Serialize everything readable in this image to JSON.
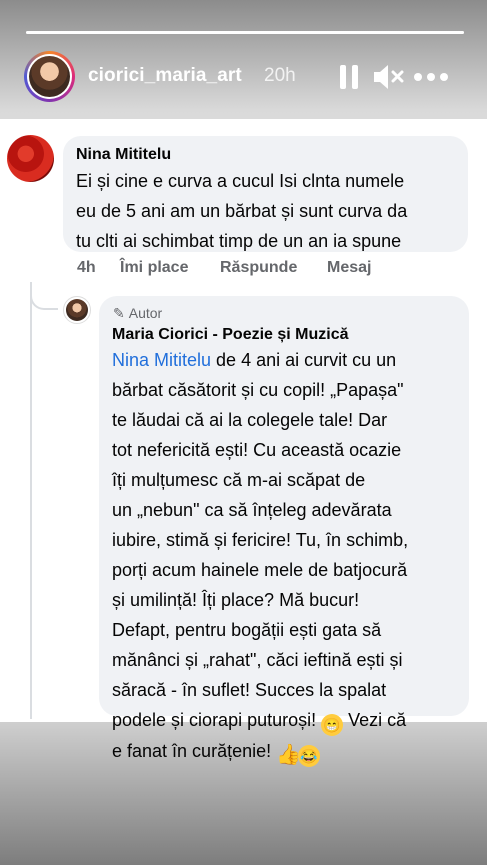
{
  "story": {
    "username": "ciorici_maria_art",
    "time_ago": "20h",
    "progress_fraction": 1.0,
    "icons": {
      "pause": "pause-icon",
      "mute": "mute-icon",
      "more": "more-icon"
    }
  },
  "comment": {
    "author": "Nina Mititelu",
    "lines": [
      "Ei și cine e curva a cucul Isi clnta numele",
      "eu de 5 ani am un bărbat și sunt curva da",
      "tu clti ai schimbat timp de un an ia spune"
    ],
    "time": "4h",
    "actions": {
      "like": "Îmi place",
      "reply": "Răspunde",
      "message": "Mesaj"
    }
  },
  "reply": {
    "badge": "Autor",
    "author": "Maria Ciorici - Poezie și Muzică",
    "mention": "Nina Mititelu",
    "first_line_rest": " de 4 ani ai curvit cu un",
    "lines": [
      "bărbat căsătorit și cu copil! „Papașa\"",
      "te lăudai că ai la colegele tale! Dar",
      "tot nefericită ești! Cu această ocazie",
      "îți mulțumesc că m-ai scăpat de",
      "un „nebun\" ca să înțeleg adevărata",
      "iubire, stimă și fericire! Tu, în schimb,",
      "porți acum hainele mele de batjocură",
      "și umilință! Îți place? Mă bucur!",
      "Defapt, pentru bogății ești gata să",
      "mănânci și „rahat\", căci ieftină ești și",
      "săracă - în suflet! Succes la spalat"
    ],
    "line_12_before_emoji": "podele și ciorapi puturoși! ",
    "line_12_after_emoji": " Vezi că",
    "line_13": "e fanat în curățenie! ",
    "emoji": {
      "grin": "😁",
      "thumb": "👍",
      "lol": "😂"
    }
  },
  "colors": {
    "mention": "#216fdb",
    "bubble": "#f0f2f5",
    "muted": "#65676b"
  }
}
